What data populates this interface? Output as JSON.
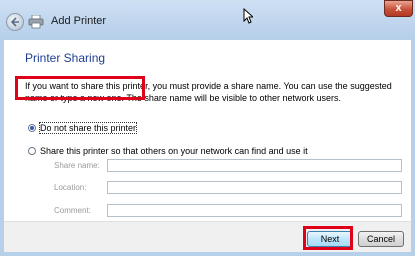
{
  "window": {
    "title": "Add Printer",
    "close_glyph": "x"
  },
  "heading": "Printer Sharing",
  "description": "If you want to share this printer, you must provide a share name. You can use the suggested name or type a new one. The share name will be visible to other network users.",
  "options": [
    {
      "label": "Do not share this printer",
      "selected": true
    },
    {
      "label": "Share this printer so that others on your network can find and use it",
      "selected": false
    }
  ],
  "fields": [
    {
      "label": "Share name:",
      "value": ""
    },
    {
      "label": "Location:",
      "value": ""
    },
    {
      "label": "Comment:",
      "value": ""
    }
  ],
  "buttons": {
    "next": "Next",
    "cancel": "Cancel"
  },
  "icons": {
    "back": "back-arrow-icon",
    "app": "printer-icon",
    "cursor": "mouse-pointer-icon"
  },
  "colors": {
    "heading": "#1e3f92",
    "highlight": "#e0001a"
  }
}
